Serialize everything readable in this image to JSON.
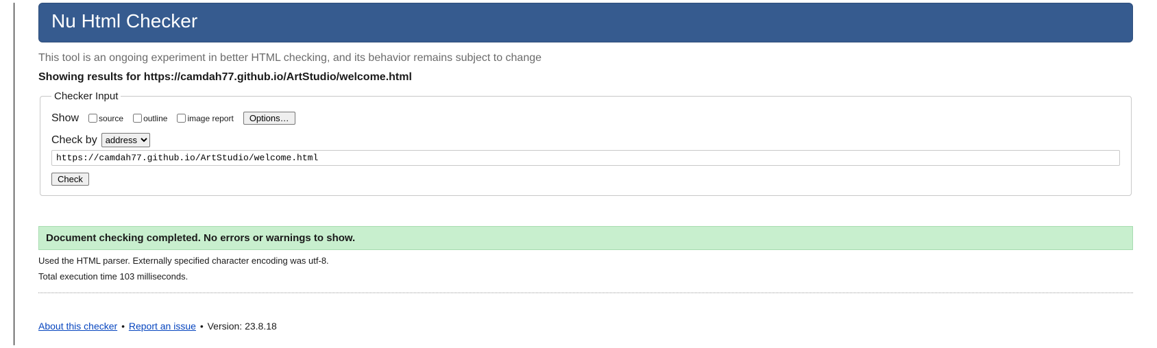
{
  "header": {
    "title": "Nu Html Checker"
  },
  "tagline": "This tool is an ongoing experiment in better HTML checking, and its behavior remains subject to change",
  "results_heading": "Showing results for https://camdah77.github.io/ArtStudio/welcome.html",
  "checker": {
    "legend": "Checker Input",
    "show_label": "Show",
    "checkboxes": {
      "source": "source",
      "outline": "outline",
      "image_report": "image report"
    },
    "options_button": "Options…",
    "check_by_label": "Check by",
    "check_by_options": [
      "address"
    ],
    "check_by_selected": "address",
    "url_value": "https://camdah77.github.io/ArtStudio/welcome.html",
    "check_button": "Check"
  },
  "result": {
    "success_message": "Document checking completed. No errors or warnings to show.",
    "parser_info": "Used the HTML parser. Externally specified character encoding was utf-8.",
    "execution_time": "Total execution time 103 milliseconds."
  },
  "footer": {
    "about_link": "About this checker",
    "report_link": "Report an issue",
    "version_label": "Version: 23.8.18"
  }
}
